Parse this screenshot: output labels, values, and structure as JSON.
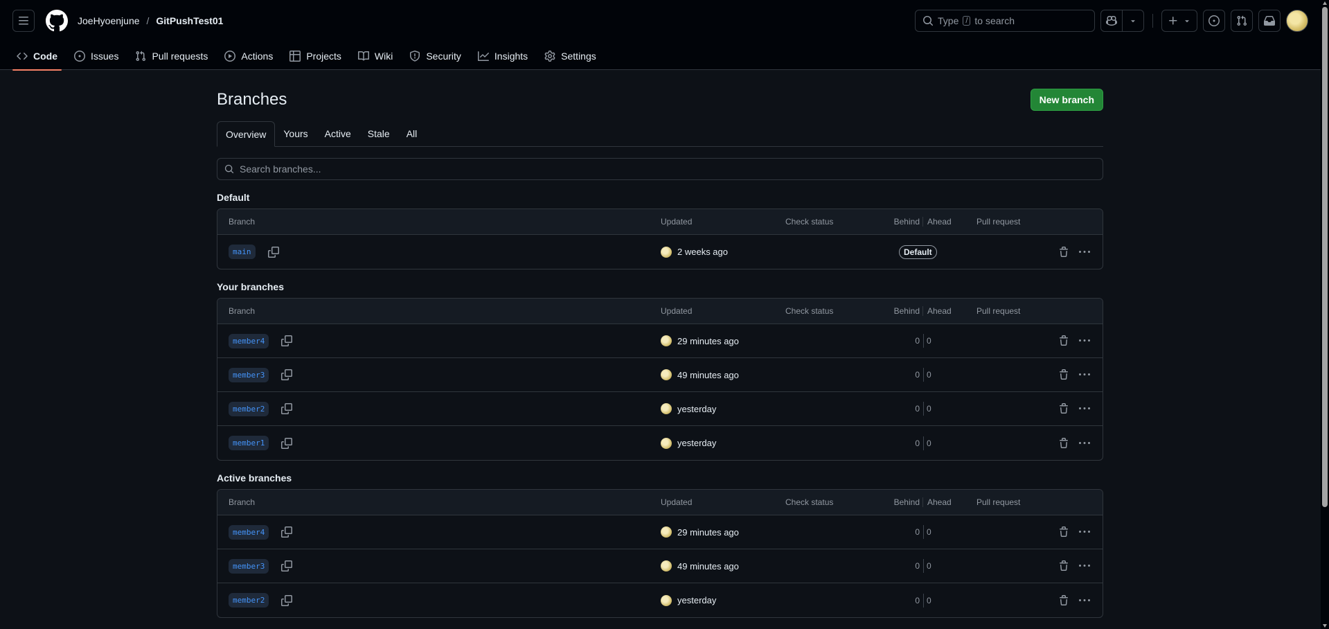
{
  "header": {
    "owner": "JoeHyoenjune",
    "separator": "/",
    "repo": "GitPushTest01",
    "search": {
      "prefix": "Type",
      "key": "/",
      "suffix": "to search"
    }
  },
  "repo_nav": {
    "items": [
      {
        "label": "Code",
        "icon": "code-icon",
        "selected": true
      },
      {
        "label": "Issues",
        "icon": "issue-opened-icon"
      },
      {
        "label": "Pull requests",
        "icon": "git-pull-request-icon"
      },
      {
        "label": "Actions",
        "icon": "play-icon"
      },
      {
        "label": "Projects",
        "icon": "table-icon"
      },
      {
        "label": "Wiki",
        "icon": "book-icon"
      },
      {
        "label": "Security",
        "icon": "shield-icon"
      },
      {
        "label": "Insights",
        "icon": "graph-icon"
      },
      {
        "label": "Settings",
        "icon": "gear-icon"
      }
    ]
  },
  "page": {
    "title": "Branches",
    "new_branch_label": "New branch",
    "tabs": [
      "Overview",
      "Yours",
      "Active",
      "Stale",
      "All"
    ],
    "active_tab": "Overview",
    "search_placeholder": "Search branches..."
  },
  "columns": {
    "branch": "Branch",
    "updated": "Updated",
    "check_status": "Check status",
    "behind": "Behind",
    "ahead": "Ahead",
    "pull_request": "Pull request"
  },
  "sections": {
    "default": {
      "title": "Default",
      "rows": [
        {
          "name": "main",
          "updated": "2 weeks ago",
          "badge": "Default"
        }
      ]
    },
    "yours": {
      "title": "Your branches",
      "rows": [
        {
          "name": "member4",
          "updated": "29 minutes ago",
          "behind": "0",
          "ahead": "0"
        },
        {
          "name": "member3",
          "updated": "49 minutes ago",
          "behind": "0",
          "ahead": "0"
        },
        {
          "name": "member2",
          "updated": "yesterday",
          "behind": "0",
          "ahead": "0"
        },
        {
          "name": "member1",
          "updated": "yesterday",
          "behind": "0",
          "ahead": "0"
        }
      ]
    },
    "active": {
      "title": "Active branches",
      "rows": [
        {
          "name": "member4",
          "updated": "29 minutes ago",
          "behind": "0",
          "ahead": "0"
        },
        {
          "name": "member3",
          "updated": "49 minutes ago",
          "behind": "0",
          "ahead": "0"
        },
        {
          "name": "member2",
          "updated": "yesterday",
          "behind": "0",
          "ahead": "0"
        }
      ]
    }
  },
  "colors": {
    "background": "#0d1117",
    "header": "#010409",
    "border": "#30363d",
    "accent_underline": "#f78166",
    "primary_button": "#238636",
    "branch_link": "#4493f8"
  }
}
